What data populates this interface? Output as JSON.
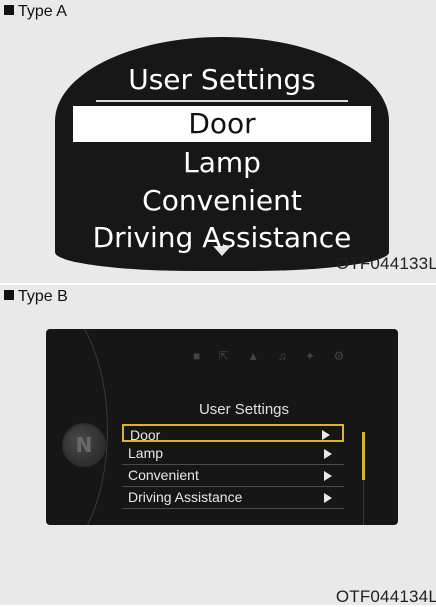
{
  "type_a": {
    "label": "Type A",
    "title": "User Settings",
    "items": [
      {
        "label": "Door",
        "selected": true
      },
      {
        "label": "Lamp",
        "selected": false
      },
      {
        "label": "Convenient",
        "selected": false
      },
      {
        "label": "Driving Assistance",
        "selected": false
      }
    ],
    "more_icon": "down-triangle",
    "code": "OTF044133L"
  },
  "type_b": {
    "label": "Type B",
    "title": "User Settings",
    "top_icons": [
      "seat-icon",
      "door-icon",
      "car-icon",
      "music-icon",
      "wrench-icon",
      "gear-icon"
    ],
    "knob_letter": "N",
    "items": [
      {
        "label": "Door",
        "selected": true
      },
      {
        "label": "Lamp",
        "selected": false
      },
      {
        "label": "Convenient",
        "selected": false
      },
      {
        "label": "Driving Assistance",
        "selected": false
      }
    ],
    "accent": "#d4b53c",
    "code": "OTF044134L"
  }
}
